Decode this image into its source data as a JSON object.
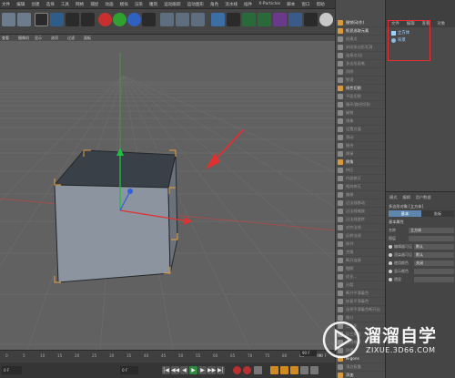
{
  "menu": [
    "文件",
    "编辑",
    "创建",
    "选择",
    "工具",
    "网格",
    "捕捉",
    "动画",
    "模拟",
    "渲染",
    "雕刻",
    "运动跟踪",
    "运动图形",
    "角色",
    "流水线",
    "插件",
    "X-Particles",
    "脚本",
    "窗口",
    "帮助"
  ],
  "viewport": {
    "menu": [
      "查看",
      "摄像机",
      "显示",
      "选项",
      "过滤",
      "面板"
    ]
  },
  "commands": [
    {
      "label": "撤销(动作)",
      "active": true
    },
    {
      "label": "框显选取元素",
      "active": true
    },
    {
      "label": "创建点",
      "active": false
    },
    {
      "label": "封闭多边形孔洞",
      "active": false
    },
    {
      "label": "连接点/边",
      "active": false
    },
    {
      "label": "多边形画笔",
      "active": false
    },
    {
      "label": "消除",
      "active": false
    },
    {
      "label": "熨烫",
      "active": false
    },
    {
      "label": "线性切割",
      "active": true
    },
    {
      "label": "平面切割",
      "active": false
    },
    {
      "label": "循环/路径切割",
      "active": false
    },
    {
      "label": "磁铁",
      "active": false
    },
    {
      "label": "镜像",
      "active": false
    },
    {
      "label": "设置点值",
      "active": false
    },
    {
      "label": "滑动",
      "active": false
    },
    {
      "label": "缝合",
      "active": false
    },
    {
      "label": "焊接",
      "active": false
    },
    {
      "label": "倒角",
      "active": true
    },
    {
      "label": "挤压",
      "active": false
    },
    {
      "label": "内部挤压",
      "active": false
    },
    {
      "label": "矩阵挤压",
      "active": false
    },
    {
      "label": "偏移",
      "active": false
    },
    {
      "label": "沿法线移动",
      "active": false
    },
    {
      "label": "沿法线缩放",
      "active": false
    },
    {
      "label": "沿法线旋转",
      "active": false
    },
    {
      "label": "对齐法线",
      "active": false
    },
    {
      "label": "反转法线",
      "active": false
    },
    {
      "label": "阵列",
      "active": false
    },
    {
      "label": "克隆",
      "active": false
    },
    {
      "label": "断开连接",
      "active": false
    },
    {
      "label": "融解",
      "active": false
    },
    {
      "label": "优化...",
      "active": false
    },
    {
      "label": "分裂",
      "active": false
    },
    {
      "label": "断开平滑着色",
      "active": false
    },
    {
      "label": "恢复平滑着色",
      "active": false
    },
    {
      "label": "选择平滑着色断开边",
      "active": false
    },
    {
      "label": "细分",
      "active": false
    },
    {
      "label": "三角化",
      "active": false
    },
    {
      "label": "反三角化",
      "active": false
    },
    {
      "label": "边到样条",
      "active": false
    },
    {
      "label": "坍塌",
      "active": false
    },
    {
      "label": "N-gons",
      "active": true
    },
    {
      "label": "顶点权重",
      "active": false
    },
    {
      "label": "添加",
      "active": true
    },
    {
      "label": "排序",
      "active": false
    }
  ],
  "object_manager": {
    "menu": [
      "文件",
      "编辑",
      "查看",
      "对象"
    ],
    "objects": [
      "立方体",
      "背景"
    ]
  },
  "attributes": {
    "tabs": [
      "模式",
      "编辑",
      "用户数据"
    ],
    "title": "多边形对象 [立方体]",
    "subtabs": [
      "基本",
      "坐标"
    ],
    "section": "基本属性",
    "rows": [
      {
        "label": "名称",
        "value": "立方体"
      },
      {
        "label": "图层",
        "value": ""
      },
      {
        "label": "编辑器可见",
        "value": "默认"
      },
      {
        "label": "渲染器可见",
        "value": "默认"
      },
      {
        "label": "使用颜色",
        "value": "关闭"
      },
      {
        "label": "显示颜色",
        "value": ""
      },
      {
        "label": "透显",
        "value": ""
      }
    ]
  },
  "timeline": {
    "ticks": [
      "0",
      "5",
      "10",
      "15",
      "20",
      "25",
      "30",
      "35",
      "40",
      "45",
      "50",
      "55",
      "60",
      "65",
      "70",
      "75",
      "80",
      "85",
      "90"
    ],
    "current_frame": "0 F",
    "start_field": "0 F",
    "end_field": "90 F",
    "end_frame": "90 F"
  },
  "watermark": {
    "title": "溜溜自学",
    "url": "ZIXUE.3D66.COM"
  },
  "colors": {
    "accent": "#5e87b0",
    "highlight": "#e03030",
    "axis_x": "#e23030",
    "axis_y": "#20c040",
    "axis_z": "#3060e0"
  }
}
